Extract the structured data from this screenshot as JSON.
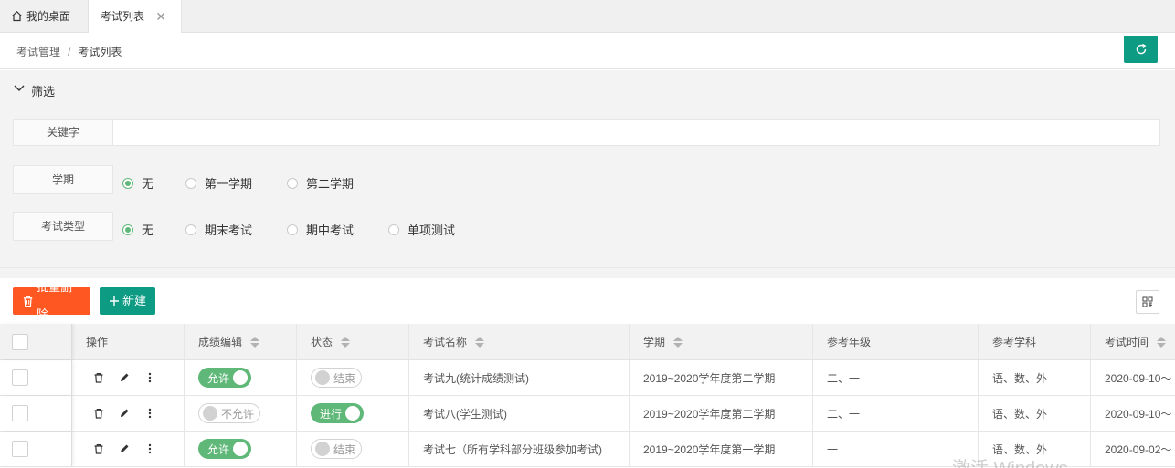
{
  "tabs": {
    "home_label": "我的桌面",
    "active_label": "考试列表",
    "close_glyph": "✕"
  },
  "breadcrumb": {
    "parent": "考试管理",
    "separator": "/",
    "current": "考试列表"
  },
  "filter": {
    "title": "筛选",
    "keyword_label": "关键字",
    "keyword_value": "",
    "semester_label": "学期",
    "semester_options": [
      "无",
      "第一学期",
      "第二学期"
    ],
    "semester_selected": "无",
    "type_label": "考试类型",
    "type_options": [
      "无",
      "期末考试",
      "期中考试",
      "单项测试"
    ],
    "type_selected": "无"
  },
  "toolbar": {
    "batch_delete_label": "批量删除",
    "new_label": "新建"
  },
  "table": {
    "headers": [
      "操作",
      "成绩编辑",
      "状态",
      "考试名称",
      "学期",
      "参考年级",
      "参考学科",
      "考试时间"
    ],
    "rows": [
      {
        "score_edit": "允许",
        "score_edit_on": true,
        "status": "结束",
        "status_on": false,
        "name": "考试九(统计成绩测试)",
        "semester": "2019~2020学年度第二学期",
        "grades": "二、一",
        "subjects": "语、数、外",
        "time": "2020-09-10～"
      },
      {
        "score_edit": "不允许",
        "score_edit_on": false,
        "status": "进行",
        "status_on": true,
        "name": "考试八(学生测试)",
        "semester": "2019~2020学年度第二学期",
        "grades": "二、一",
        "subjects": "语、数、外",
        "time": "2020-09-10～"
      },
      {
        "score_edit": "允许",
        "score_edit_on": true,
        "status": "结束",
        "status_on": false,
        "name": "考试七（所有学科部分班级参加考试)",
        "semester": "2019~2020学年度第一学期",
        "grades": "一",
        "subjects": "语、数、外",
        "time": "2020-09-02～"
      }
    ]
  },
  "watermark": "激活 Windows",
  "colors": {
    "accent": "#0e9b84",
    "danger": "#ff5722",
    "switch_on": "#5fb878"
  }
}
